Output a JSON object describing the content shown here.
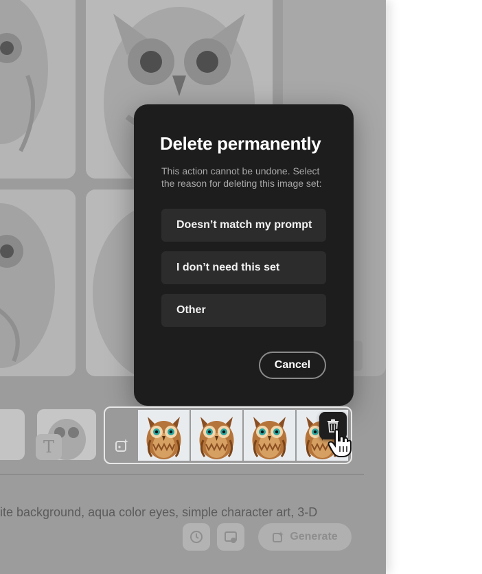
{
  "dialog": {
    "title": "Delete permanently",
    "description": "This action cannot be undone. Select the reason for deleting this image set:",
    "reasons": [
      {
        "label": "Doesn’t match my prompt"
      },
      {
        "label": "I don’t need this set"
      },
      {
        "label": "Other"
      }
    ],
    "cancel_label": "Cancel"
  },
  "background": {
    "prompt_text": "ite background, aqua color eyes, simple character art, 3-D",
    "generate_label": "Generate",
    "text_thumb_glyph": "T"
  },
  "image_set": {
    "thumbnail_count": 4,
    "icons": [
      "generative-set-icon",
      "trash-icon"
    ]
  },
  "colors": {
    "dialog_bg": "#1d1d1d",
    "button_bg": "#2c2c2c",
    "overlay_gray": "#9c9c9c"
  }
}
